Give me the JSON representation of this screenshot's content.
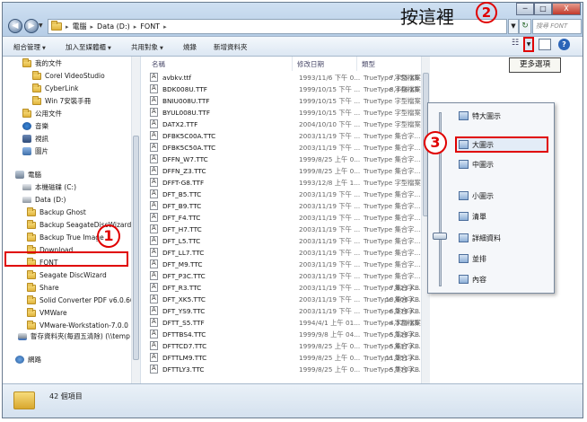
{
  "titlebar": {
    "breadcrumb": [
      "電腦",
      "Data (D:)",
      "FONT"
    ],
    "search_placeholder": "搜尋 FONT",
    "window_buttons": [
      "─",
      "□",
      "X"
    ]
  },
  "toolbar": {
    "items": [
      "組合管理",
      "加入至媒體櫃",
      "共用對象",
      "燒錄",
      "新增資料夾"
    ],
    "more_options_tooltip": "更多選項"
  },
  "annotations": {
    "click_here": "按這裡",
    "step1": "1",
    "step2": "2",
    "step3": "3"
  },
  "navpane": {
    "items": [
      {
        "label": "我的文件",
        "icon": "folder"
      },
      {
        "label": "Corel VideoStudio",
        "icon": "folder"
      },
      {
        "label": "CyberLink",
        "icon": "folder"
      },
      {
        "label": "Win 7安裝手冊",
        "icon": "folder"
      },
      {
        "label": "公用文件",
        "icon": "folder"
      },
      {
        "label": "音樂",
        "icon": "music"
      },
      {
        "label": "視訊",
        "icon": "video"
      },
      {
        "label": "圖片",
        "icon": "picture"
      },
      {
        "label": "電腦",
        "icon": "computer"
      },
      {
        "label": "本機磁碟 (C:)",
        "icon": "drive"
      },
      {
        "label": "Data (D:)",
        "icon": "drive"
      },
      {
        "label": "Backup Ghost",
        "icon": "folder"
      },
      {
        "label": "Backup SeagateDiscWizard",
        "icon": "folder"
      },
      {
        "label": "Backup True Image",
        "icon": "folder"
      },
      {
        "label": "Download",
        "icon": "folder"
      },
      {
        "label": "FONT",
        "icon": "folder"
      },
      {
        "label": "Seagate DiscWizard",
        "icon": "folder"
      },
      {
        "label": "Share",
        "icon": "folder"
      },
      {
        "label": "Solid Converter PDF v6.0.664",
        "icon": "folder"
      },
      {
        "label": "VMWare",
        "icon": "folder"
      },
      {
        "label": "VMware-Workstation-7.0.0",
        "icon": "folder"
      },
      {
        "label": "暫存資料夾(每週五清除) (\\\\temp",
        "icon": "share"
      },
      {
        "label": "網路",
        "icon": "network"
      }
    ]
  },
  "filelist": {
    "columns": [
      "名稱",
      "修改日期",
      "類型"
    ],
    "rows": [
      {
        "name": "avbkv.ttf",
        "date": "1993/11/6 下午 0...",
        "type": "TrueType 字型檔案"
      },
      {
        "name": "BDK008U.TTF",
        "date": "1999/10/15 下午 ...",
        "type": "TrueType 字型檔案"
      },
      {
        "name": "BNIU008U.TTF",
        "date": "1999/10/15 下午 ...",
        "type": "TrueType 字型檔案"
      },
      {
        "name": "BYUL008U.TTF",
        "date": "1999/10/15 下午 ...",
        "type": "TrueType 字型檔案"
      },
      {
        "name": "DATX2.TTF",
        "date": "2004/10/10 下午 ...",
        "type": "TrueType 字型檔案"
      },
      {
        "name": "DFBK5C00A.TTC",
        "date": "2003/11/19 下午 ...",
        "type": "TrueType 集合字..."
      },
      {
        "name": "DFBK5C50A.TTC",
        "date": "2003/11/19 下午 ...",
        "type": "TrueType 集合字..."
      },
      {
        "name": "DFFN_W7.TTC",
        "date": "1999/8/25 上午 0...",
        "type": "TrueType 集合字..."
      },
      {
        "name": "DFFN_Z3.TTC",
        "date": "1999/8/25 上午 0...",
        "type": "TrueType 集合字..."
      },
      {
        "name": "DFFT-G8.TTF",
        "date": "1993/12/8 上午 1...",
        "type": "TrueType 字型檔案"
      },
      {
        "name": "DFT_B5.TTC",
        "date": "2003/11/19 下午 ...",
        "type": "TrueType 集合字..."
      },
      {
        "name": "DFT_B9.TTC",
        "date": "2003/11/19 下午 ...",
        "type": "TrueType 集合字..."
      },
      {
        "name": "DFT_F4.TTC",
        "date": "2003/11/19 下午 ...",
        "type": "TrueType 集合字..."
      },
      {
        "name": "DFT_H7.TTC",
        "date": "2003/11/19 下午 ...",
        "type": "TrueType 集合字..."
      },
      {
        "name": "DFT_L5.TTC",
        "date": "2003/11/19 下午 ...",
        "type": "TrueType 集合字..."
      },
      {
        "name": "DFT_LL7.TTC",
        "date": "2003/11/19 下午 ...",
        "type": "TrueType 集合字..."
      },
      {
        "name": "DFT_M9.TTC",
        "date": "2003/11/19 下午 ...",
        "type": "TrueType 集合字..."
      },
      {
        "name": "DFT_P3C.TTC",
        "date": "2003/11/19 下午 ...",
        "type": "TrueType 集合字..."
      },
      {
        "name": "DFT_R3.TTC",
        "date": "2003/11/19 下午 ...",
        "type": "TrueType 集合字..."
      },
      {
        "name": "DFT_XK5.TTC",
        "date": "2003/11/19 下午 ...",
        "type": "TrueType 集合字..."
      },
      {
        "name": "DFT_YS9.TTC",
        "date": "2003/11/19 下午 ...",
        "type": "TrueType 集合字..."
      },
      {
        "name": "DFTT_S5.TTF",
        "date": "1994/4/1 上午 01...",
        "type": "TrueType 字型檔案"
      },
      {
        "name": "DFTTBS4.TTC",
        "date": "1999/9/8 上午 04...",
        "type": "TrueType 集合字..."
      },
      {
        "name": "DFTTCD7.TTC",
        "date": "1999/8/25 上午 0...",
        "type": "TrueType 集合字..."
      },
      {
        "name": "DFTTLM9.TTC",
        "date": "1999/8/25 上午 0...",
        "type": "TrueType 集合字..."
      },
      {
        "name": "DFTTLY3.TTC",
        "date": "1999/8/25 上午 0...",
        "type": "TrueType 集合字..."
      }
    ],
    "visible_sizes": [
      {
        "row": 0,
        "size": "7,455 KB"
      },
      {
        "row": 1,
        "size": "8,446 KB"
      },
      {
        "row": 18,
        "size": "7,823 KB"
      },
      {
        "row": 19,
        "size": "10,606 KB"
      },
      {
        "row": 20,
        "size": "6,278 KB"
      },
      {
        "row": 21,
        "size": "4,529 KB"
      },
      {
        "row": 22,
        "size": "5,128 KB"
      },
      {
        "row": 23,
        "size": "5,637 KB"
      },
      {
        "row": 24,
        "size": "11,251 KB"
      },
      {
        "row": 25,
        "size": "5,770 KB"
      }
    ]
  },
  "viewmenu": {
    "items": [
      {
        "label": "特大圖示"
      },
      {
        "label": "大圖示"
      },
      {
        "label": "中圖示"
      },
      {
        "label": "小圖示"
      },
      {
        "label": "清單"
      },
      {
        "label": "詳細資料"
      },
      {
        "label": "並排"
      },
      {
        "label": "內容"
      }
    ]
  },
  "statusbar": {
    "item_count": "42 個項目"
  },
  "colors": {
    "annotation_red": "#e00000",
    "titlebar_blue": "#cfe0f2"
  }
}
